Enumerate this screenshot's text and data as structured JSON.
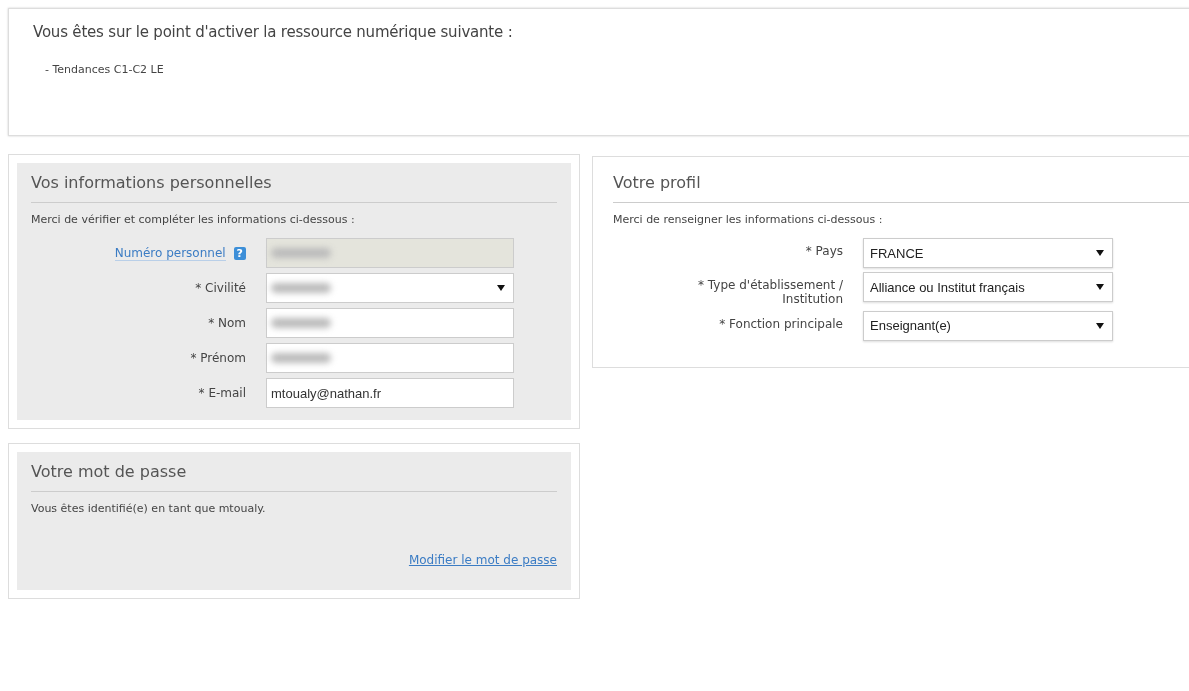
{
  "intro": {
    "text": "Vous êtes sur le point d'activer la ressource numérique suivante :",
    "items": [
      "- Tendances C1-C2 LE"
    ]
  },
  "personal": {
    "title": "Vos informations personnelles",
    "instructions": "Merci de vérifier et compléter les informations ci-dessous :",
    "fields": [
      {
        "label": "Numéro personnel",
        "link": true,
        "help": "?",
        "kind": "input",
        "disabled": true,
        "redacted": true
      },
      {
        "label": "* Civilité",
        "link": false,
        "kind": "select",
        "disabled": false,
        "redacted": true
      },
      {
        "label": "* Nom",
        "link": false,
        "kind": "input",
        "disabled": false,
        "redacted": true
      },
      {
        "label": "* Prénom",
        "link": false,
        "kind": "input",
        "disabled": false,
        "redacted": true
      },
      {
        "label": "* E-mail",
        "link": false,
        "kind": "input",
        "disabled": false,
        "redacted": false,
        "value": "mtoualy@nathan.fr"
      }
    ]
  },
  "password": {
    "title": "Votre mot de passe",
    "text": "Vous êtes identifié(e) en tant que mtoualy.",
    "link": "Modifier le mot de passe"
  },
  "profile": {
    "title": "Votre profil",
    "instructions": "Merci de renseigner les informations ci-dessous :",
    "fields": [
      {
        "label": "* Pays",
        "value": "FRANCE"
      },
      {
        "label": "* Type d'établissement / Institution",
        "value": "Alliance ou Institut français"
      },
      {
        "label": "* Fonction principale",
        "value": "Enseignant(e)"
      }
    ]
  }
}
